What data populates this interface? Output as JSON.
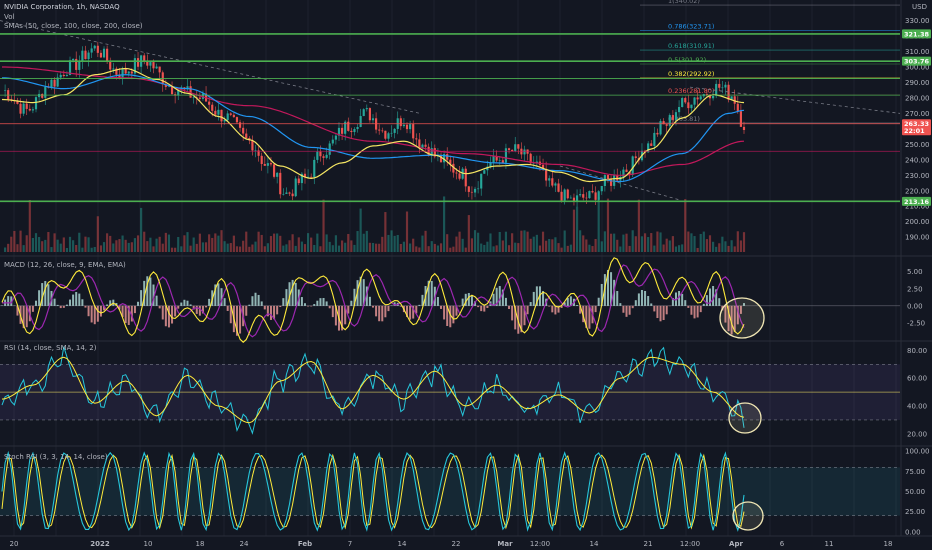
{
  "header": {
    "symbol_line": "NVIDIA Corporation, 1h, NASDAQ",
    "vol_label": "Vol",
    "sma_label": "SMAs (50, close, 100, close, 200, close)",
    "currency": "USD",
    "macd_label": "MACD (12, 26, close, 9, EMA, EMA)",
    "rsi_label": "RSI (14, close, SMA, 14, 2)",
    "stoch_label": "Stoch RSI (3, 3, 14, 14, close)"
  },
  "colors": {
    "background": "#131722",
    "up": "#26a69a",
    "down": "#ef5350",
    "sma50": "#f5e663",
    "sma100": "#2196f3",
    "sma200": "#c2185b",
    "hline_green": "#4caf50",
    "macd_line": "#ffeb3b",
    "signal_line": "#9c27b0",
    "rsi_line": "#26c6da",
    "rsi_ma": "#ffeb3b",
    "stoch_k": "#26c6da",
    "stoch_d": "#ffeb3b",
    "annotation": "#f0e6b4"
  },
  "price_axis": {
    "ticks": [
      "330.00",
      "320.00",
      "310.00",
      "300.00",
      "290.00",
      "280.00",
      "270.00",
      "260.00",
      "250.00",
      "240.00",
      "230.00",
      "220.00",
      "210.00",
      "200.00",
      "190.00"
    ],
    "tags": [
      {
        "text": "321.38",
        "color": "#4caf50"
      },
      {
        "text": "303.76",
        "color": "#4caf50"
      },
      {
        "text": "263.33",
        "color": "#ef5350"
      },
      {
        "text": "22:01",
        "color": "#ef5350"
      },
      {
        "text": "213.16",
        "color": "#4caf50"
      }
    ]
  },
  "fib_labels": [
    "1(340.02)",
    "0.786(323.71)",
    "0.618(310.91)",
    "0.5(301.92)",
    "0.382(292.92)",
    "0.236(281.80)",
    "0(263.81)"
  ],
  "macd_axis": [
    "5.00",
    "2.50",
    "0.00",
    "-2.50"
  ],
  "rsi_axis": [
    "80.00",
    "60.00",
    "40.00",
    "20.00"
  ],
  "stoch_axis": [
    "100.00",
    "75.00",
    "50.00",
    "25.00",
    "0.00"
  ],
  "time_axis": [
    "20",
    "2022",
    "10",
    "18",
    "24",
    "Feb",
    "7",
    "14",
    "22",
    "Mar",
    "12:00",
    "14",
    "21",
    "12:00",
    "Apr",
    "6",
    "11",
    "18"
  ],
  "chart_data": {
    "type": "candlestick",
    "title": "NVIDIA Corporation, 1h, NASDAQ",
    "ylim": [
      183,
      342
    ],
    "last_price": 263.33,
    "horizontal_levels": [
      321.38,
      303.76,
      292.5,
      281.8,
      263.33,
      245.5,
      213.16
    ],
    "sma50": [
      [
        0,
        279
      ],
      [
        10,
        277
      ],
      [
        20,
        282
      ],
      [
        30,
        295
      ],
      [
        40,
        299
      ],
      [
        50,
        292
      ],
      [
        60,
        283
      ],
      [
        70,
        268
      ],
      [
        80,
        253
      ],
      [
        90,
        236
      ],
      [
        100,
        228
      ],
      [
        110,
        238
      ],
      [
        120,
        249
      ],
      [
        130,
        252
      ],
      [
        140,
        243
      ],
      [
        150,
        231
      ],
      [
        160,
        236
      ],
      [
        170,
        237
      ],
      [
        180,
        232
      ],
      [
        190,
        226
      ],
      [
        200,
        228
      ],
      [
        210,
        247
      ],
      [
        220,
        267
      ],
      [
        230,
        282
      ],
      [
        240,
        277
      ]
    ],
    "sma100": [
      [
        0,
        293
      ],
      [
        20,
        286
      ],
      [
        40,
        295
      ],
      [
        60,
        286
      ],
      [
        80,
        268
      ],
      [
        100,
        248
      ],
      [
        120,
        241
      ],
      [
        140,
        243
      ],
      [
        160,
        238
      ],
      [
        180,
        233
      ],
      [
        200,
        226
      ],
      [
        220,
        244
      ],
      [
        235,
        270
      ],
      [
        240,
        272
      ]
    ],
    "sma200": [
      [
        0,
        300
      ],
      [
        40,
        293
      ],
      [
        80,
        275
      ],
      [
        120,
        252
      ],
      [
        150,
        244
      ],
      [
        180,
        237
      ],
      [
        200,
        230
      ],
      [
        220,
        237
      ],
      [
        240,
        252
      ]
    ],
    "macd": [
      [
        0,
        0.5
      ],
      [
        10,
        -2.0
      ],
      [
        20,
        4.8
      ],
      [
        30,
        1.5
      ],
      [
        40,
        -3.0
      ],
      [
        50,
        3.0
      ],
      [
        60,
        -2.5
      ],
      [
        70,
        2.0
      ],
      [
        80,
        -4.0
      ],
      [
        90,
        -2.0
      ],
      [
        100,
        5.5
      ],
      [
        110,
        -1.5
      ],
      [
        120,
        4.0
      ],
      [
        130,
        -2.0
      ],
      [
        140,
        2.5
      ],
      [
        150,
        -1.0
      ],
      [
        160,
        3.5
      ],
      [
        170,
        -2.0
      ],
      [
        180,
        2.0
      ],
      [
        190,
        -2.5
      ],
      [
        200,
        6.0
      ],
      [
        210,
        4.0
      ],
      [
        220,
        2.0
      ],
      [
        230,
        3.0
      ],
      [
        240,
        -2.8
      ]
    ],
    "rsi": [
      [
        0,
        45
      ],
      [
        10,
        55
      ],
      [
        20,
        75
      ],
      [
        30,
        42
      ],
      [
        40,
        58
      ],
      [
        50,
        33
      ],
      [
        60,
        62
      ],
      [
        70,
        40
      ],
      [
        80,
        28
      ],
      [
        90,
        58
      ],
      [
        100,
        72
      ],
      [
        110,
        38
      ],
      [
        120,
        62
      ],
      [
        130,
        45
      ],
      [
        140,
        65
      ],
      [
        150,
        40
      ],
      [
        160,
        55
      ],
      [
        170,
        38
      ],
      [
        180,
        48
      ],
      [
        190,
        35
      ],
      [
        200,
        60
      ],
      [
        210,
        75
      ],
      [
        220,
        70
      ],
      [
        230,
        50
      ],
      [
        240,
        32
      ]
    ],
    "stoch_rsi": {
      "oscillation_range": [
        0,
        100
      ],
      "last": 18
    }
  }
}
